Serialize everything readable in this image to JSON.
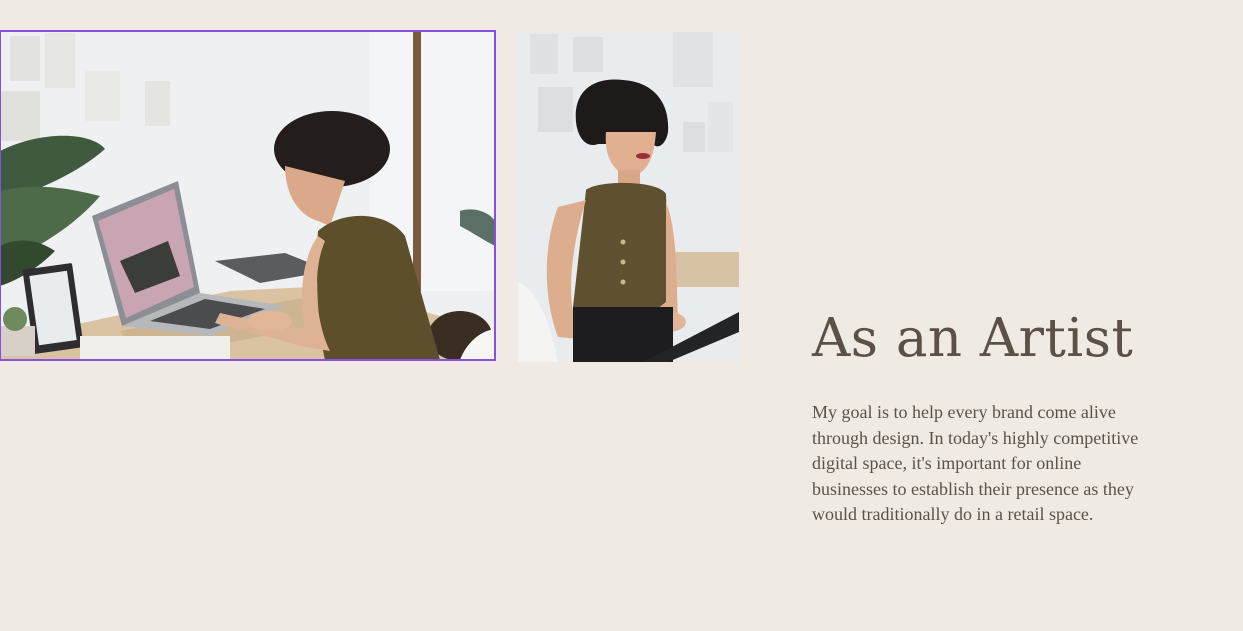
{
  "section": {
    "heading": "As an Artist",
    "paragraph": "My goal is to help every brand come alive through design. In today's highly competitive digital space, it's important for online businesses to establish their presence as they would traditionally do in a retail space."
  },
  "images": [
    {
      "name": "artist-at-laptop",
      "selected": true,
      "outline_color": "#8a4fe0"
    },
    {
      "name": "artist-portrait",
      "selected": false
    }
  ],
  "colors": {
    "background": "#efeae4",
    "text": "#5b5148",
    "selection": "#8a4fe0"
  }
}
